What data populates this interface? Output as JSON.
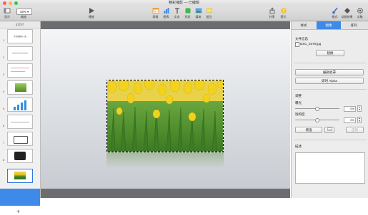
{
  "window": {
    "title": "精彩缩影 — 已编辑"
  },
  "toolbar": {
    "display_label": "显示",
    "zoom_value": "43%",
    "zoom_label": "缩放",
    "play_label": "播放",
    "items": [
      {
        "label": "表格",
        "icon": "table-icon"
      },
      {
        "label": "图表",
        "icon": "chart-icon"
      },
      {
        "label": "文本",
        "icon": "text-icon"
      },
      {
        "label": "形状",
        "icon": "shape-icon"
      },
      {
        "label": "媒体",
        "icon": "media-icon"
      },
      {
        "label": "批注",
        "icon": "comment-icon"
      }
    ],
    "share_label": "共享",
    "tips_label": "提示",
    "format_label": "格式",
    "animate_label": "动画效果",
    "document_label": "文稿"
  },
  "sidebar": {
    "header": "幻灯片",
    "slide_numbers": [
      "1",
      "2",
      "3",
      "4",
      "5",
      "6",
      "7",
      "8",
      "9"
    ],
    "slide1_text": "学堂教程第一课",
    "add_label": "+"
  },
  "inspector": {
    "tabs": [
      "样式",
      "图像",
      "排列"
    ],
    "active_tab": "图像",
    "file_info_label": "文件信息",
    "file_name": "DSC_0278.jpg",
    "replace_label": "替换",
    "edit_mask_label": "编辑遮罩",
    "instant_alpha_label": "即时 Alpha",
    "adjust_label": "调整",
    "exposure_label": "曝光",
    "exposure_value": "0%",
    "exposure_level": 0.5,
    "saturation_label": "饱和度",
    "saturation_value": "0%",
    "saturation_level": 0.5,
    "enhance_label": "增强",
    "reset_label": "还原",
    "description_label": "描述"
  },
  "colors": {
    "accent": "#3d8ae8",
    "canvas": "#6c6d70"
  }
}
